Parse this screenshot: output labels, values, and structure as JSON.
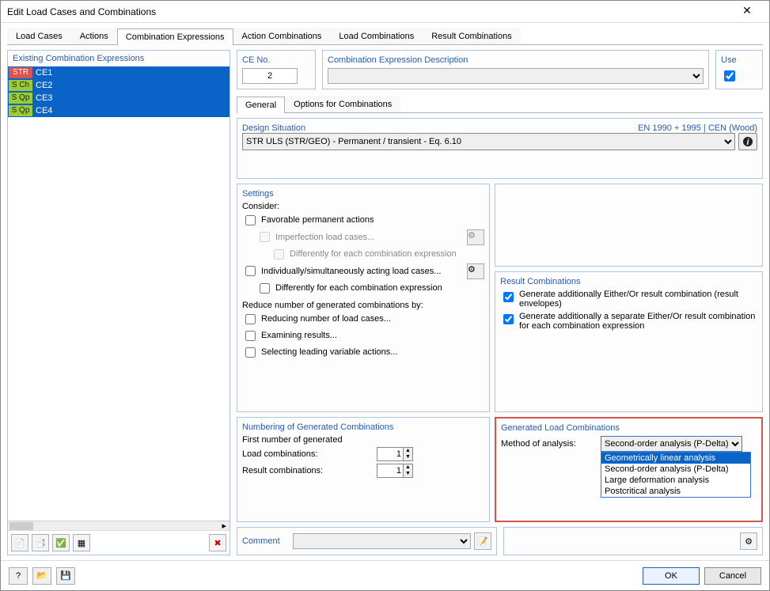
{
  "window": {
    "title": "Edit Load Cases and Combinations"
  },
  "tabs": {
    "items": [
      "Load Cases",
      "Actions",
      "Combination Expressions",
      "Action Combinations",
      "Load Combinations",
      "Result Combinations"
    ],
    "active": 2
  },
  "left": {
    "title": "Existing Combination Expressions",
    "items": [
      {
        "tag": "STR",
        "tagClass": "str",
        "name": "CE1"
      },
      {
        "tag": "S Ch",
        "tagClass": "sch",
        "name": "CE2"
      },
      {
        "tag": "S Qp",
        "tagClass": "sqp",
        "name": "CE3"
      },
      {
        "tag": "S Qp",
        "tagClass": "sqp",
        "name": "CE4"
      }
    ]
  },
  "ce": {
    "no_label": "CE No.",
    "no_value": "2",
    "desc_label": "Combination Expression Description",
    "desc_value": "",
    "use_label": "Use",
    "use_checked": true
  },
  "subtabs": {
    "items": [
      "General",
      "Options for Combinations"
    ],
    "active": 0
  },
  "design": {
    "label": "Design Situation",
    "standard": "EN 1990 + 1995 | CEN (Wood)",
    "value": "STR ULS (STR/GEO) - Permanent / transient - Eq. 6.10",
    "tag": "STR"
  },
  "settings": {
    "title": "Settings",
    "consider": "Consider:",
    "favorable": "Favorable permanent actions",
    "imperfection": "Imperfection load cases...",
    "diff_each1": "Differently for each combination expression",
    "individually": "Individually/simultaneously acting load cases...",
    "diff_each2": "Differently for each combination expression",
    "reduce_label": "Reduce number of generated combinations by:",
    "reducing": "Reducing number of load cases...",
    "examining": "Examining results...",
    "selecting": "Selecting leading variable actions..."
  },
  "resultcomb": {
    "title": "Result Combinations",
    "gen1": "Generate additionally Either/Or result combination (result envelopes)",
    "gen2": "Generate additionally a separate Either/Or result combination for each combination expression"
  },
  "numbering": {
    "title": "Numbering of Generated Combinations",
    "first": "First number of generated",
    "load": "Load combinations:",
    "load_val": "1",
    "result": "Result combinations:",
    "result_val": "1"
  },
  "genload": {
    "title": "Generated Load Combinations",
    "method_label": "Method of analysis:",
    "method_value": "Second-order analysis (P-Delta)",
    "options": [
      "Geometrically linear analysis",
      "Second-order analysis (P-Delta)",
      "Large deformation analysis",
      "Postcritical analysis"
    ],
    "selected_option": 0
  },
  "comment": {
    "label": "Comment",
    "value": ""
  },
  "footer": {
    "ok": "OK",
    "cancel": "Cancel"
  }
}
